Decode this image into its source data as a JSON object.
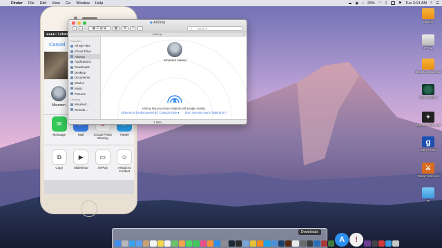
{
  "menubar": {
    "app_name": "Finder",
    "menus": [
      "File",
      "Edit",
      "View",
      "Go",
      "Window",
      "Help"
    ],
    "battery": "25%",
    "clock": "Tue 3:13 AM"
  },
  "desktop_icons": [
    {
      "label": "Backup",
      "icon": "external-drive-icon"
    },
    {
      "label": "FAT32",
      "icon": "drive-icon"
    },
    {
      "label": "Macintosh External",
      "icon": "external-drive-icon"
    },
    {
      "label": "Time Machine",
      "icon": "time-machine-icon"
    },
    {
      "label": "Counter-Strike 1.6",
      "icon": "counter-strike-icon"
    },
    {
      "label": "Garry's Mod",
      "icon": "garrys-mod-icon"
    },
    {
      "label": "Team Fortress 2",
      "icon": "team-fortress-icon"
    },
    {
      "label": "TF",
      "icon": "folder-icon"
    }
  ],
  "iphone": {
    "carrier": "Lebara",
    "cancel_label": "Cancel",
    "airdrop_contact": "Moumen",
    "share_apps": [
      {
        "label": "Message",
        "color": "#34c759",
        "glyph": "✉"
      },
      {
        "label": "Mail",
        "color": "#3a86f5",
        "glyph": "✉"
      },
      {
        "label": "iCloud Photo Sharing",
        "color": "#f4f4f4",
        "glyph": "✿"
      },
      {
        "label": "Twitter",
        "color": "#2aa3ef",
        "glyph": "🐦"
      }
    ],
    "action_items": [
      {
        "label": "Copy",
        "glyph": "⧉"
      },
      {
        "label": "Slideshow",
        "glyph": "▶"
      },
      {
        "label": "AirPlay",
        "glyph": "▭"
      },
      {
        "label": "Assign to Contact",
        "glyph": "☺"
      }
    ]
  },
  "finder": {
    "title": "AirDrop",
    "tab_label": "AirDrop",
    "search_placeholder": "Search",
    "sidebar": {
      "favorites_header": "Favorites",
      "favorites": [
        "All My Files",
        "iCloud Drive",
        "AirDrop",
        "Applications",
        "Downloads",
        "Desktop",
        "Documents",
        "Movies",
        "Music",
        "Pictures"
      ],
      "selected": "AirDrop",
      "devices_header": "Devices",
      "devices": [
        "Moumen'...",
        "Remote..."
      ]
    },
    "airdrop_user": "Moumen Hamid",
    "airdrop_text": "AirDrop lets you share instantly with people nearby.",
    "discover_link": "Allow me to be discovered by: Contacts Only ▾",
    "help_link": "Don't see who you're looking for?",
    "status": "1 item"
  },
  "dock": {
    "tooltip": "Downloads",
    "apps": [
      {
        "name": "finder",
        "color": "#3e8ef0"
      },
      {
        "name": "launchpad",
        "color": "#b7b7c0"
      },
      {
        "name": "safari",
        "color": "#3aa2ea"
      },
      {
        "name": "mail",
        "color": "#5a9ef2"
      },
      {
        "name": "contacts",
        "color": "#c8a271"
      },
      {
        "name": "calendar",
        "color": "#f5f5f5"
      },
      {
        "name": "notes",
        "color": "#f5d94b"
      },
      {
        "name": "reminders",
        "color": "#f5f5f5"
      },
      {
        "name": "maps",
        "color": "#6cc36b"
      },
      {
        "name": "photos",
        "color": "#f0a64b"
      },
      {
        "name": "messages",
        "color": "#4cd964"
      },
      {
        "name": "facetime",
        "color": "#3fc85b"
      },
      {
        "name": "itunes",
        "color": "#e94f86"
      },
      {
        "name": "ibooks",
        "color": "#f29437"
      },
      {
        "name": "app-store",
        "color": "#2c8ff0"
      },
      {
        "name": "system-preferences",
        "color": "#8d8d93"
      },
      {
        "name": "steam",
        "color": "#1b2838"
      },
      {
        "name": "terminal",
        "color": "#2b2b2b"
      },
      {
        "name": "preview",
        "color": "#7aa4d6"
      },
      {
        "name": "chrome",
        "color": "#e3c23a"
      },
      {
        "name": "vlc",
        "color": "#f08a1d"
      },
      {
        "name": "skype",
        "color": "#1ea3e6"
      },
      {
        "name": "xcode",
        "color": "#4c8fd6"
      },
      {
        "name": "photoshop",
        "color": "#1d3f66"
      },
      {
        "name": "illustrator",
        "color": "#5a2b10"
      },
      {
        "name": "textedit",
        "color": "#e9e9e9"
      },
      {
        "name": "calculator",
        "color": "#6a6a6a"
      },
      {
        "name": "activity-monitor",
        "color": "#3d3d3d"
      },
      {
        "name": "quicktime",
        "color": "#2d6fb7"
      },
      {
        "name": "dictionary",
        "color": "#a83a3a"
      },
      {
        "name": "grapher",
        "color": "#3e7c3e"
      }
    ],
    "large_apps": [
      {
        "name": "app-store-large",
        "color": "#2c8ff0",
        "glyph": "A"
      },
      {
        "name": "alert-app-large",
        "color": "#f0f0f0",
        "glyph": "!"
      }
    ],
    "trailing_apps": [
      {
        "name": "textmate",
        "color": "#6d3b8f"
      },
      {
        "name": "pen-app",
        "color": "#444444"
      },
      {
        "name": "red-app",
        "color": "#d23b3b"
      },
      {
        "name": "downloads-stack",
        "color": "#3a9be0"
      },
      {
        "name": "trash",
        "color": "#c8c8c8"
      }
    ]
  }
}
